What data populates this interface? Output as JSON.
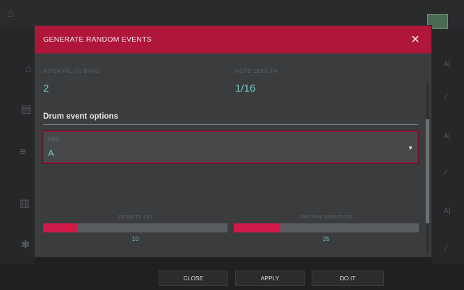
{
  "dialog": {
    "title": "GENERATE RANDOM EVENTS",
    "close_icon": "close-icon",
    "params": [
      {
        "label": "INTERVAL (S) BARS",
        "value": "2"
      },
      {
        "label": "NOTE LENGTH",
        "value": "1/16"
      }
    ],
    "section_title": "Drum event options",
    "select": {
      "label": "PAD",
      "value": "A"
    },
    "sliders": [
      {
        "label": "DENSITY (%)",
        "value": "10",
        "fill": 0.19
      },
      {
        "label": "RHYTHM VARIATION",
        "value": "25",
        "fill": 0.25
      }
    ]
  },
  "actions": {
    "close": "CLOSE",
    "apply": "APPLY",
    "do_it": "DO IT"
  },
  "colors": {
    "header": "#b0153a",
    "accent": "#d11a4a",
    "value_text": "#76c6c6"
  }
}
